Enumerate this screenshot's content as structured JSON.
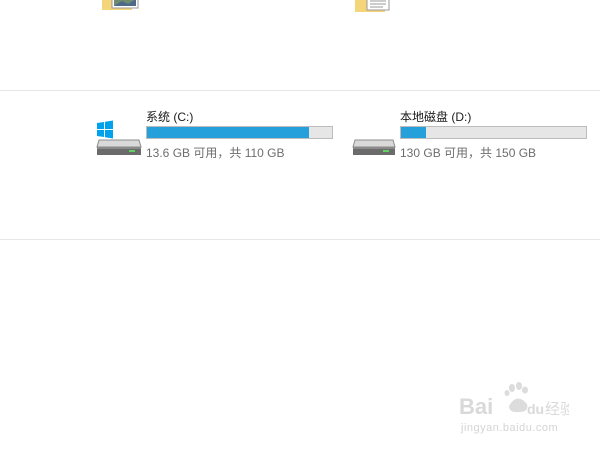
{
  "top_folders": [
    {
      "icon": "pictures-folder-icon"
    },
    {
      "icon": "documents-folder-icon"
    }
  ],
  "drives": [
    {
      "name": "系统 (C:)",
      "space_text": "13.6 GB 可用，共 110 GB",
      "used_fraction": 0.876,
      "icon": "windows-system-drive-icon"
    },
    {
      "name": "本地磁盘 (D:)",
      "space_text": "130 GB 可用，共 150 GB",
      "used_fraction": 0.133,
      "icon": "hard-drive-icon"
    }
  ],
  "colors": {
    "bar_fill": "#26a0da",
    "bar_track": "#e6e6e6",
    "windows_logo": "#00a2ed"
  },
  "watermark": {
    "logo": "Baidu 经验",
    "url": "jingyan.baidu.com"
  }
}
